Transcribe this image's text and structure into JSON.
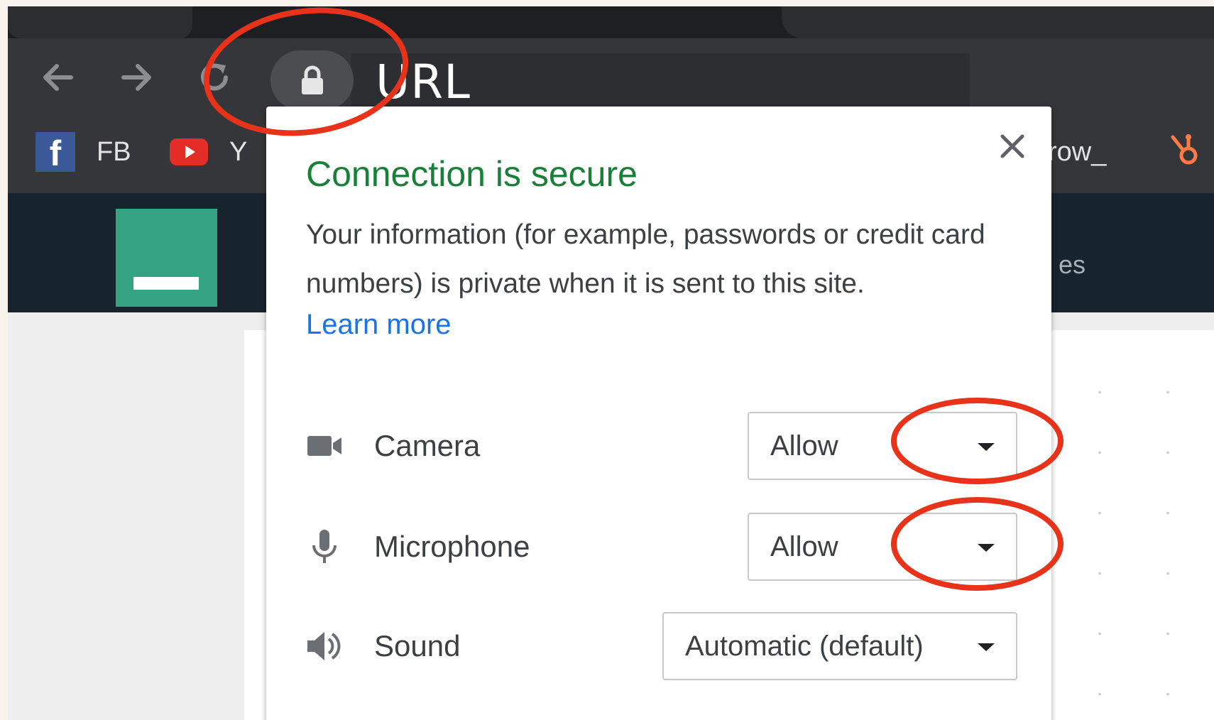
{
  "browser": {
    "address_bar": {
      "text": "URL"
    },
    "nav": {
      "back_icon": "arrow-left-icon",
      "forward_icon": "arrow-right-icon",
      "reload_icon": "reload-icon"
    },
    "site_info_icon": "lock-icon",
    "bookmarks": [
      {
        "label": "FB",
        "icon": "facebook-icon"
      },
      {
        "label": "Y",
        "icon": "youtube-icon"
      },
      {
        "label": "row_",
        "icon": ""
      },
      {
        "label": "",
        "icon": "hubspot-icon"
      }
    ]
  },
  "site": {
    "nav_partial_text": "es",
    "logo_color": "#33a384",
    "header_color": "#17232d"
  },
  "popup": {
    "title": "Connection is secure",
    "description": "Your information (for example, passwords or credit card numbers) is private when it is sent to this site.",
    "learn_more": "Learn more",
    "close_icon": "close-icon",
    "title_color": "#188038",
    "link_color": "#1a73e8",
    "permissions": [
      {
        "label": "Camera",
        "icon": "camera-icon",
        "value": "Allow"
      },
      {
        "label": "Microphone",
        "icon": "microphone-icon",
        "value": "Allow"
      },
      {
        "label": "Sound",
        "icon": "speaker-icon",
        "value": "Automatic (default)"
      }
    ]
  },
  "annotations": {
    "color": "#e8321a",
    "highlighted": [
      "lock-icon",
      "camera-dropdown-caret",
      "microphone-dropdown-caret"
    ]
  }
}
